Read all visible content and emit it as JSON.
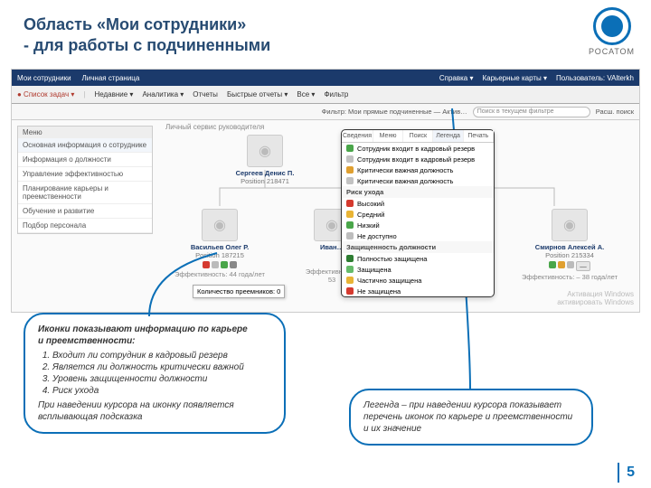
{
  "slide": {
    "title_l1": "Область «Мои сотрудники»",
    "title_l2": "- для работы с подчиненными",
    "pagenum": "5",
    "brand": "РОСАТОМ"
  },
  "topbar": {
    "left": [
      "Мои сотрудники",
      "Личная страница"
    ],
    "right": [
      "Справка ▾",
      "Карьерные карты ▾",
      "Пользователь: VAlterkh"
    ]
  },
  "toolbar": {
    "items": [
      "● Список задач ▾",
      "Недавние ▾",
      "Аналитика ▾",
      "Отчеты",
      "Быстрые отчеты ▾",
      "Все ▾",
      "Фильтр"
    ]
  },
  "filter": {
    "label": "Фильтр: Мои прямые подчиненные — Актив…",
    "search_placeholder": "Поиск в текущем фильтре",
    "adv_search": "Расш. поиск"
  },
  "sidemenu": {
    "title": "Меню",
    "items": [
      "Основная информация о сотруднике",
      "Информация о должности",
      "Управление эффективностью",
      "Планирование карьеры и преемственности",
      "Обучение и развитие",
      "Подбор персонала"
    ]
  },
  "workspace_title": "Личный сервис руководителя",
  "cards": {
    "top": {
      "name": "Сергеев Денис П.",
      "pos": "Position 218471"
    },
    "left": {
      "name": "Васильев Олег Р.",
      "pos": "Position 187215",
      "eff": "Эффективность: 44 года/лет"
    },
    "mid": {
      "name": "Иван…",
      "eff": "Эффективность: 53"
    },
    "right": {
      "name": "Смирнов Алексей А.",
      "pos": "Position 215334",
      "eff": "Эффективность: – 38 года/лет"
    }
  },
  "tooltip_small": "Количество преемников: 0",
  "legend": {
    "tabs": [
      "Сведения",
      "Меню",
      "Поиск",
      "Легенда",
      "Печать"
    ],
    "group1": {
      "title": "",
      "rows": [
        {
          "c": "#4aa64a",
          "t": "Сотрудник входит в кадровый резерв"
        },
        {
          "c": "#c2c2c2",
          "t": "Сотрудник входит в кадровый резерв"
        },
        {
          "c": "#e0a030",
          "t": "Критически важная должность"
        },
        {
          "c": "#c2c2c2",
          "t": "Критически важная должность"
        }
      ]
    },
    "group2": {
      "title": "Риск ухода",
      "rows": [
        {
          "c": "#d53a2f",
          "t": "Высокий"
        },
        {
          "c": "#e9b435",
          "t": "Средний"
        },
        {
          "c": "#4aa64a",
          "t": "Низкий"
        },
        {
          "c": "#bdbdbd",
          "t": "Не доступно"
        }
      ]
    },
    "group3": {
      "title": "Защищенность должности",
      "rows": [
        {
          "c": "#2e7d32",
          "t": "Полностью защищена"
        },
        {
          "c": "#66bb6a",
          "t": "Защищена"
        },
        {
          "c": "#e9b435",
          "t": "Частично защищена"
        },
        {
          "c": "#d53a2f",
          "t": "Не защищена"
        }
      ]
    }
  },
  "callout_left": {
    "head": "Иконки показывают информацию по карьере",
    "head2": "и преемственности:",
    "items": [
      "Входит ли сотрудник в кадровый резерв",
      "Является ли должность критически важной",
      "Уровень защищенности должности",
      "Риск ухода"
    ],
    "foot": "При наведении курсора на иконку появляется всплывающая подсказка"
  },
  "callout_right": "Легенда – при наведении курсора показывает перечень иконок по карьере и преемственности и их значение",
  "watermark": {
    "l1": "Активация Windows",
    "l2": "активировать Windows"
  }
}
